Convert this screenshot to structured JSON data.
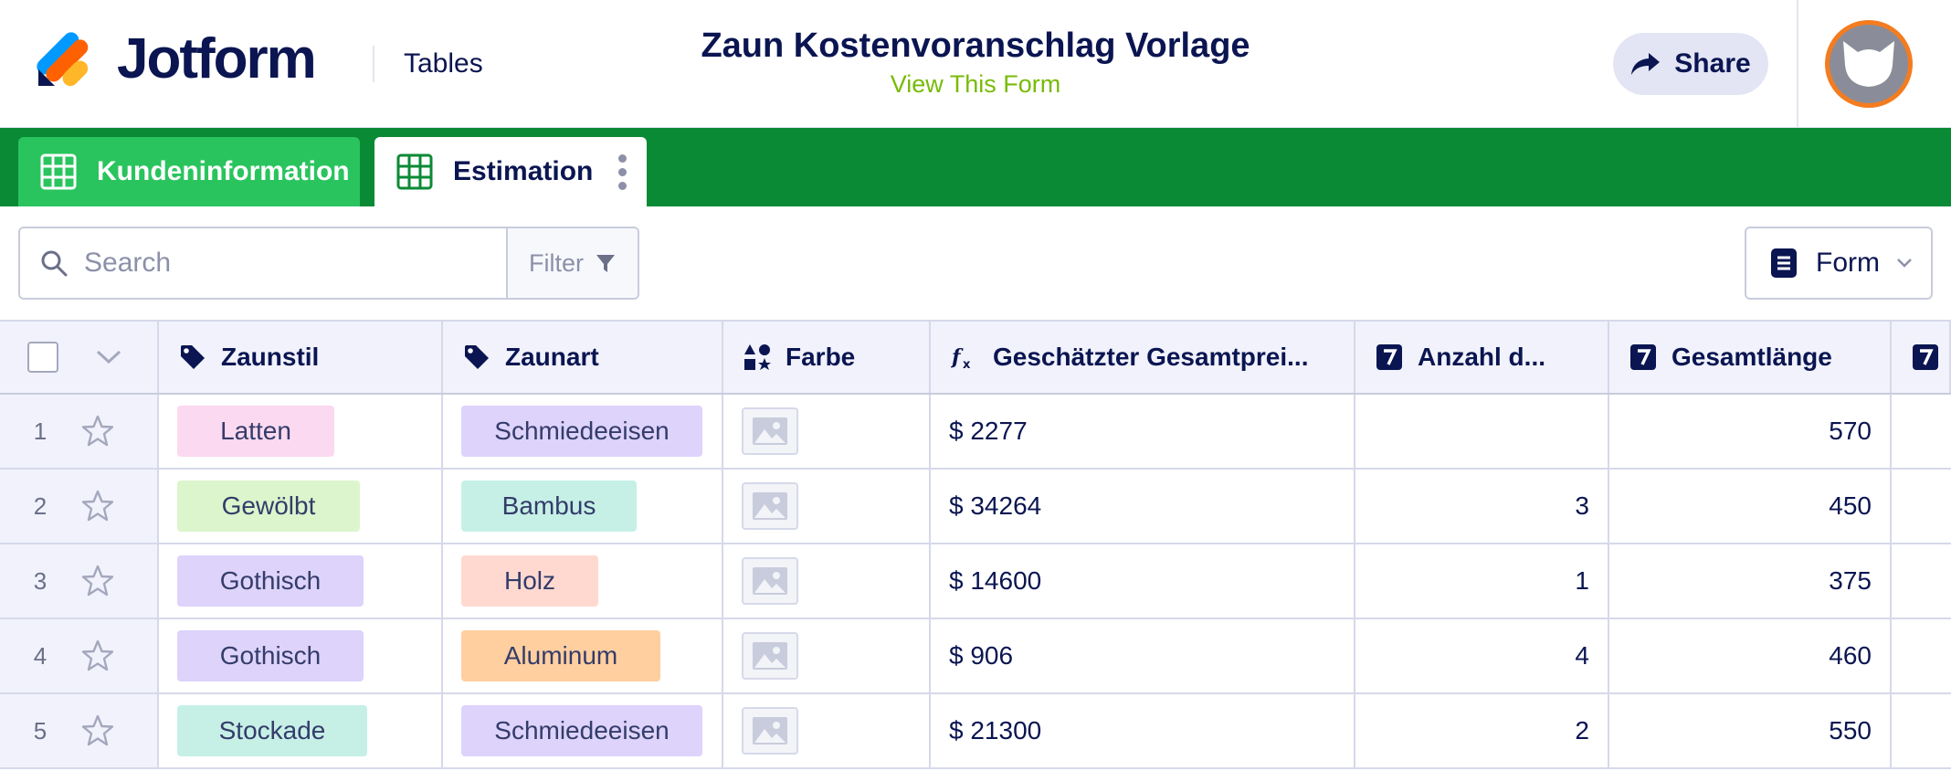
{
  "header": {
    "brand": "Jotform",
    "section": "Tables",
    "form_title": "Zaun Kostenvoranschlag Vorlage",
    "view_link": "View This Form",
    "share_label": "Share",
    "avatar_icon": "cat-avatar-icon"
  },
  "colors": {
    "brand_navy": "#0a1551",
    "tabbar_green": "#0b8a35",
    "active_tab_green": "#2ac45e",
    "link_green": "#78bb07",
    "avatar_ring": "#f47c1f"
  },
  "tabs": [
    {
      "label": "Kundeninformation",
      "icon": "grid-table-icon"
    },
    {
      "label": "Estimation",
      "icon": "grid-table-icon",
      "active": true
    }
  ],
  "toolbar": {
    "search_placeholder": "Search",
    "filter_label": "Filter",
    "form_label": "Form"
  },
  "table": {
    "columns": [
      {
        "label": "Zaunstil",
        "icon": "tag-icon"
      },
      {
        "label": "Zaunart",
        "icon": "tag-icon"
      },
      {
        "label": "Farbe",
        "icon": "shapes-icon"
      },
      {
        "label": "Geschätzter Gesamtprei...",
        "icon": "formula-icon"
      },
      {
        "label": "Anzahl d...",
        "icon": "number-icon"
      },
      {
        "label": "Gesamtlänge",
        "icon": "number-icon"
      },
      {
        "label": "",
        "icon": "number-icon"
      }
    ],
    "rows": [
      {
        "num": "1",
        "zaunstil": "Latten",
        "zaunart": "Schmiedeeisen",
        "price": "$ 2277",
        "anzahl": "",
        "laenge": "570"
      },
      {
        "num": "2",
        "zaunstil": "Gewölbt",
        "zaunart": "Bambus",
        "price": "$ 34264",
        "anzahl": "3",
        "laenge": "450"
      },
      {
        "num": "3",
        "zaunstil": "Gothisch",
        "zaunart": "Holz",
        "price": "$ 14600",
        "anzahl": "1",
        "laenge": "375"
      },
      {
        "num": "4",
        "zaunstil": "Gothisch",
        "zaunart": "Aluminum",
        "price": "$ 906",
        "anzahl": "4",
        "laenge": "460"
      },
      {
        "num": "5",
        "zaunstil": "Stockade",
        "zaunart": "Schmiedeeisen",
        "price": "$ 21300",
        "anzahl": "2",
        "laenge": "550"
      }
    ],
    "tag_colors": {
      "Latten": "#fbd9f0",
      "Gewölbt": "#dcf5cc",
      "Gothisch": "#ddd3fb",
      "Stockade": "#c6f0e6",
      "Schmiedeeisen": "#ddd3fb",
      "Bambus": "#c6f0e6",
      "Holz": "#ffd9d0",
      "Aluminum": "#ffcf9f"
    }
  }
}
